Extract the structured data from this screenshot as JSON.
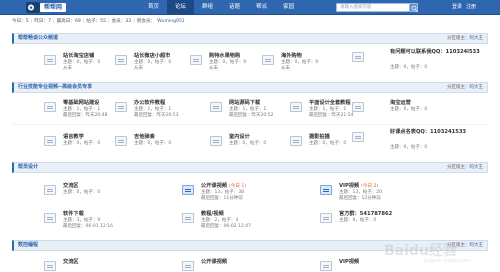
{
  "header": {
    "logo_text": "帮帮网",
    "nav": [
      "首页",
      "论坛",
      "群组",
      "话题",
      "帮派",
      "家园"
    ],
    "active_nav": 1,
    "search_placeholder": "请输入搜索内容",
    "user_links": [
      "登录",
      "注册"
    ]
  },
  "stats": {
    "today": "今日：5",
    "yesterday": "昨日：7",
    "max_day": "最高日：69",
    "posts": "帖子：55",
    "members": "会员：33",
    "newest_label": "新会员：",
    "newest_member": "Wuming951"
  },
  "sections": [
    {
      "title": "帮帮畅谈公众频道",
      "mods_label": "分区版主：",
      "mods_value": "阿大王",
      "forums": [
        {
          "name": "站长淘宝店铺",
          "today": "",
          "stat": "主题：0，帖子：0",
          "last": "从未"
        },
        {
          "name": "站长微店小超市",
          "today": "",
          "stat": "主题：0，帖子：0",
          "last": "从未"
        },
        {
          "name": "购特水果物购",
          "today": "",
          "stat": "主题：0，帖子：0",
          "last": "从未"
        },
        {
          "name": "海外购物",
          "today": "",
          "stat": "主题：0，帖子：0",
          "last": "从未"
        },
        {
          "name": "有问题可以联系我QQ：110324l533",
          "today": "",
          "stat": "主题：0，帖子：0",
          "last": "从未"
        }
      ]
    },
    {
      "title": "行业技能专业视频--高级会员专享",
      "mods_label": "分区版主：",
      "mods_value": "阿大王",
      "forums": [
        {
          "name": "零基础网站建设",
          "today": "",
          "stat": "主题：1，帖子：1",
          "last": "最后回复：昨天20:48"
        },
        {
          "name": "办公软件教程",
          "today": "",
          "stat": "主题：1，帖子：1",
          "last": "最后回复：昨天20:53"
        },
        {
          "name": "网站源码下载",
          "today": "",
          "stat": "主题：1，帖子：1",
          "last": "最后回复：昨天20:52"
        },
        {
          "name": "平面设计全套教程",
          "today": "",
          "stat": "主题：1，帖子：1",
          "last": "最后回复：昨天21:54"
        },
        {
          "name": "淘宝运营",
          "today": "",
          "stat": "主题：0，帖子：0",
          "last": "从未"
        },
        {
          "name": "语言教学",
          "today": "",
          "stat": "主题：0，帖子：0",
          "last": "从未"
        },
        {
          "name": "吉他弹奏",
          "today": "",
          "stat": "主题：0，帖子：0",
          "last": "从未"
        },
        {
          "name": "室内设计",
          "today": "",
          "stat": "主题：0，帖子：0",
          "last": "从未"
        },
        {
          "name": "摄影拍摄",
          "today": "",
          "stat": "主题：0，帖子：0",
          "last": "从未"
        },
        {
          "name": "好课点名表QQ：1103241533",
          "today": "",
          "stat": "主题：0，帖子：0",
          "last": "从未"
        }
      ]
    },
    {
      "title": "帮员设计",
      "mods_label": "分区版主：",
      "mods_value": "阿大王",
      "forums": [
        {
          "name": "交流区",
          "today": "",
          "stat": "主题：0，帖子：0",
          "last": "从未"
        },
        {
          "name": "公开课视频",
          "today": "(今日 1)",
          "stat": "主题：13，帖子：38",
          "last": "最后回复：11分钟前"
        },
        {
          "name": "VIP视频",
          "today": "(今日 2)",
          "stat": "主题：13，帖子：20",
          "last": "最后回复：12分钟前"
        },
        {
          "name": "软件下载",
          "today": "",
          "stat": "主题：3，帖子：9",
          "last": "最后回复：06-01 12:16"
        },
        {
          "name": "教程/视频",
          "today": "",
          "stat": "主题：2，帖子：4",
          "last": "最后回复：06-02 12:47"
        },
        {
          "name": "官方群：541787862",
          "today": "",
          "stat": "主题：0，帖子：0",
          "last": "从未"
        }
      ]
    },
    {
      "title": "数控编程",
      "mods_label": "分区版主：",
      "mods_value": "阿大王",
      "forums": [
        {
          "name": "交流区",
          "today": "",
          "stat": "",
          "last": ""
        },
        {
          "name": "公开课视频",
          "today": "",
          "stat": "",
          "last": ""
        },
        {
          "name": "VIP视频",
          "today": "",
          "stat": "",
          "last": ""
        }
      ]
    }
  ],
  "watermark": {
    "text": "Baidu经验",
    "sub": "jingyan.baidu.com"
  }
}
